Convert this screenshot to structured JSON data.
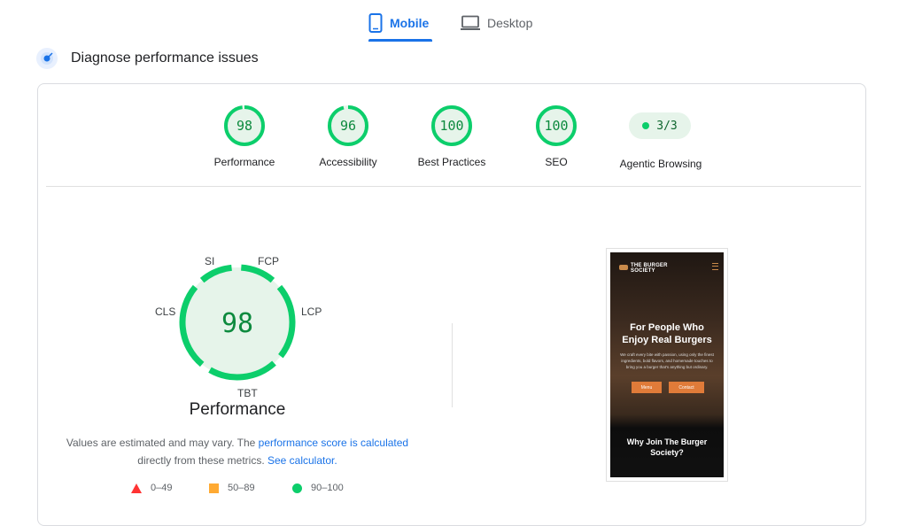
{
  "tabs": {
    "mobile": "Mobile",
    "desktop": "Desktop"
  },
  "section_title": "Diagnose performance issues",
  "categories": [
    {
      "label": "Performance",
      "score": "98",
      "fraction": 0.98
    },
    {
      "label": "Accessibility",
      "score": "96",
      "fraction": 0.96
    },
    {
      "label": "Best Practices",
      "score": "100",
      "fraction": 1.0
    },
    {
      "label": "SEO",
      "score": "100",
      "fraction": 1.0
    }
  ],
  "agentic": {
    "label": "Agentic Browsing",
    "value": "3/3"
  },
  "performance": {
    "score": "98",
    "title": "Performance",
    "metrics": {
      "si": "SI",
      "fcp": "FCP",
      "lcp": "LCP",
      "tbt": "TBT",
      "cls": "CLS"
    }
  },
  "estimate": {
    "text1": "Values are estimated and may vary. The ",
    "link1": "performance score is calculated",
    "text2": "directly from these metrics. ",
    "link2": "See calculator."
  },
  "legend": [
    {
      "range": "0–49",
      "color": "#ff3333",
      "shape": "triangle"
    },
    {
      "range": "50–89",
      "color": "#ffaa33",
      "shape": "square"
    },
    {
      "range": "90–100",
      "color": "#0cce6b",
      "shape": "circle"
    }
  ],
  "preview": {
    "logo": "THE BURGER SOCIETY",
    "hero_title": "For People Who Enjoy Real Burgers",
    "hero_text": "We craft every bite with passion, using only the finest ingredients, bold flavors, and homemade touches to bring you a burger that's anything but ordinary.",
    "btn_menu": "Menu",
    "btn_contact": "Contact",
    "section_title": "Why Join The Burger Society?"
  },
  "colors": {
    "good": "#0cce6b",
    "good_text": "#0d8a3e",
    "good_bg": "#e6f4ea",
    "accent": "#1a73e8"
  }
}
